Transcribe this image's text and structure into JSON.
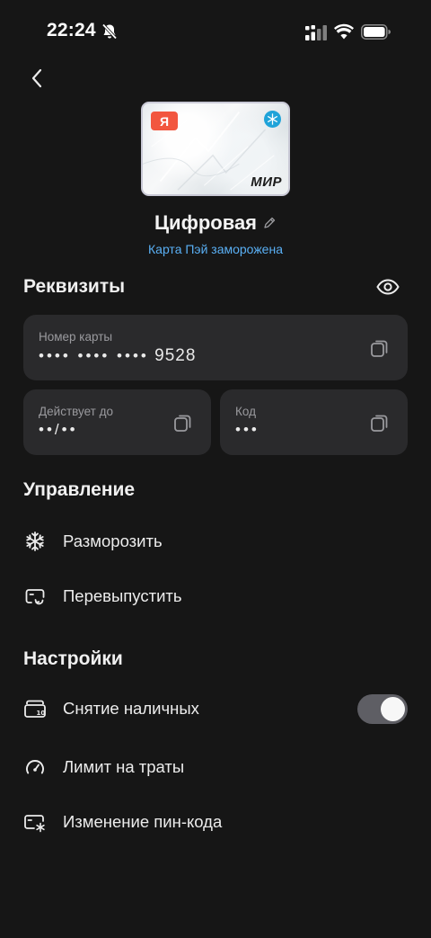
{
  "status_bar": {
    "time": "22:24",
    "icons": [
      "bell-off-icon",
      "signal-icon",
      "wifi-icon",
      "battery-icon"
    ]
  },
  "navigation": {
    "back_icon": "chevron-left-icon"
  },
  "card": {
    "logo_letter": "Я",
    "network": "МИР",
    "name": "Цифровая",
    "status": "Карта Пэй заморожена",
    "colors": {
      "logo": "#f2563f",
      "frozen_badge": "#1fa3d9",
      "status_text": "#5ab0f5"
    }
  },
  "requisites": {
    "title": "Реквизиты",
    "card_number": {
      "label": "Номер карты",
      "masked": "•••• •••• ••••",
      "last4": "9528"
    },
    "valid_until": {
      "label": "Действует до",
      "value": "••/••"
    },
    "code": {
      "label": "Код",
      "value": "•••"
    }
  },
  "management": {
    "title": "Управление",
    "items": [
      {
        "label": "Разморозить",
        "icon": "snowflake-icon"
      },
      {
        "label": "Перевыпустить",
        "icon": "card-reissue-icon"
      }
    ]
  },
  "settings": {
    "title": "Настройки",
    "items": [
      {
        "label": "Снятие наличных",
        "icon": "cash-withdrawal-icon",
        "toggle": true
      },
      {
        "label": "Лимит на траты",
        "icon": "speedometer-icon"
      },
      {
        "label": "Изменение пин-кода",
        "icon": "pin-change-icon"
      }
    ]
  }
}
